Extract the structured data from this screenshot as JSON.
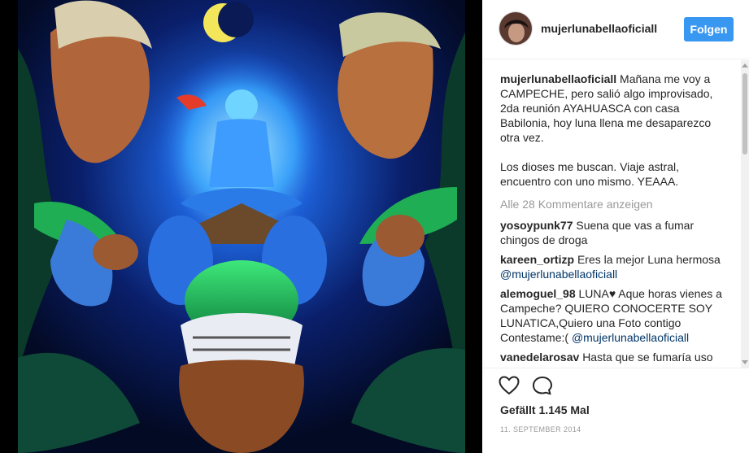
{
  "post": {
    "username": "mujerlunabellaoficiall",
    "follow_label": "Folgen",
    "caption": {
      "username": "mujerlunabellaoficiall",
      "lines": [
        "Mañana me voy a",
        "CAMPECHE, pero salió algo improvisado,",
        "2da reunión AYAHUASCA con casa",
        "Babilonia, hoy luna llena me desaparezco",
        "otra vez."
      ],
      "lines2": [
        "Los dioses me buscan. Viaje astral,",
        "encuentro con uno mismo. YEAAA."
      ]
    },
    "load_more": "Alle 28 Kommentare anzeigen",
    "comments": [
      {
        "user": "yosoypunk77",
        "text": "Suena que vas a fumar chingos de droga"
      },
      {
        "user": "kareen_ortizp",
        "text": "Eres la mejor Luna hermosa",
        "mention": "@mujerlunabellaoficiall"
      },
      {
        "user": "alemoguel_98",
        "text": "LUNA♥ Aque horas vienes a Campeche? QUIERO CONOCERTE SOY LUNATICA,Quiero una Foto contigo Contestame:(",
        "mention": "@mujerlunabellaoficiall"
      },
      {
        "user": "vanedelarosav",
        "text": "Hasta que se fumaría uso"
      }
    ],
    "likes": "Gefällt 1.145 Mal",
    "date": "11. September 2014"
  },
  "icons": {
    "like": "heart-icon",
    "comment": "speech-bubble-icon",
    "avatar": "avatar"
  },
  "colors": {
    "accent": "#3897f0",
    "muted": "#999999",
    "mention": "#003569"
  }
}
